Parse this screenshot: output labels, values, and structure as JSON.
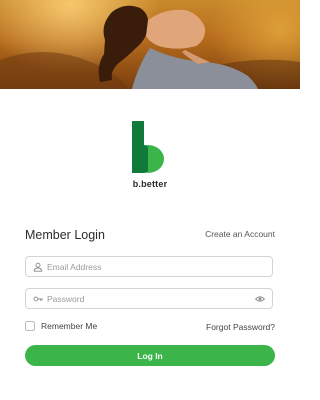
{
  "brand": {
    "name": "b.better",
    "colors": {
      "dark_green": "#0f7a3a",
      "light_green": "#3bb54a"
    }
  },
  "login": {
    "title": "Member Login",
    "create_account": "Create an Account",
    "email": {
      "placeholder": "Email Address",
      "value": "",
      "icon": "user-icon"
    },
    "password": {
      "placeholder": "Password",
      "value": "",
      "icon": "key-icon",
      "toggle_icon": "eye-icon"
    },
    "remember_me": {
      "label": "Remember Me",
      "checked": false
    },
    "forgot_password": "Forgot Password?",
    "submit_label": "Log In"
  }
}
